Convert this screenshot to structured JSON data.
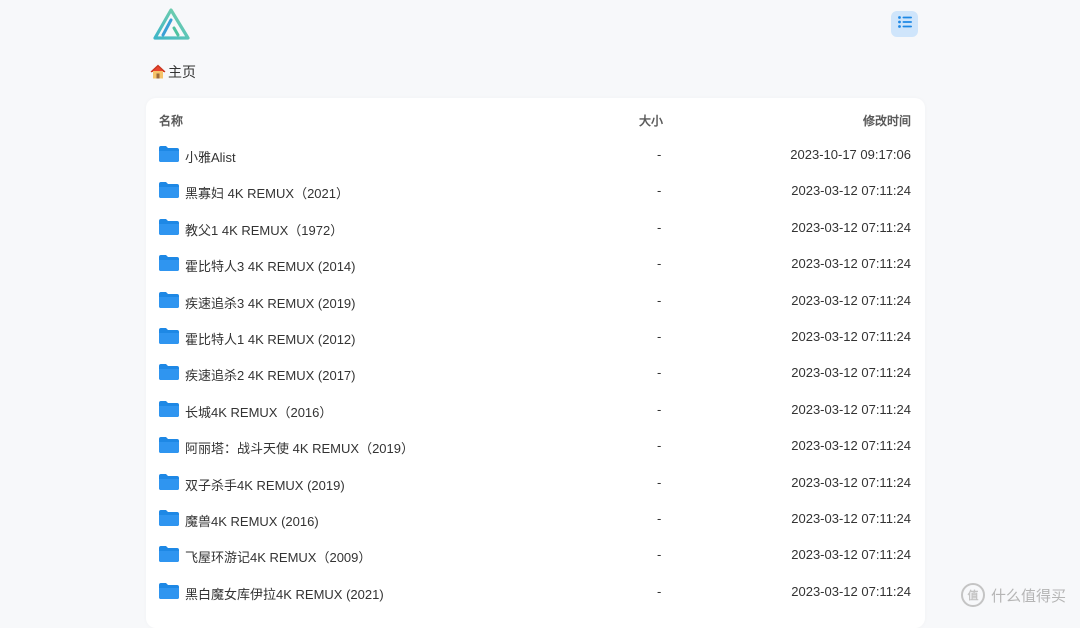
{
  "header": {
    "logo_icon": "alist-logo-icon",
    "menu_icon": "list-icon",
    "accent": "#1e88e5"
  },
  "breadcrumb": {
    "home_icon": "house-icon",
    "label": "主页"
  },
  "table": {
    "columns": [
      "名称",
      "大小",
      "修改时间"
    ],
    "rows": [
      {
        "name": "小雅Alist",
        "size": "-",
        "modified": "2023-10-17 09:17:06"
      },
      {
        "name": "黑寡妇 4K REMUX（2021）",
        "size": "-",
        "modified": "2023-03-12 07:11:24"
      },
      {
        "name": "教父1 4K REMUX（1972）",
        "size": "-",
        "modified": "2023-03-12 07:11:24"
      },
      {
        "name": "霍比特人3 4K REMUX (2014)",
        "size": "-",
        "modified": "2023-03-12 07:11:24"
      },
      {
        "name": "疾速追杀3 4K REMUX (2019)",
        "size": "-",
        "modified": "2023-03-12 07:11:24"
      },
      {
        "name": "霍比特人1 4K REMUX (2012)",
        "size": "-",
        "modified": "2023-03-12 07:11:24"
      },
      {
        "name": "疾速追杀2 4K REMUX (2017)",
        "size": "-",
        "modified": "2023-03-12 07:11:24"
      },
      {
        "name": "长城4K REMUX（2016）",
        "size": "-",
        "modified": "2023-03-12 07:11:24"
      },
      {
        "name": "阿丽塔：战斗天使 4K REMUX（2019）",
        "size": "-",
        "modified": "2023-03-12 07:11:24"
      },
      {
        "name": "双子杀手4K REMUX (2019)",
        "size": "-",
        "modified": "2023-03-12 07:11:24"
      },
      {
        "name": "魔兽4K REMUX (2016)",
        "size": "-",
        "modified": "2023-03-12 07:11:24"
      },
      {
        "name": "飞屋环游记4K REMUX（2009）",
        "size": "-",
        "modified": "2023-03-12 07:11:24"
      },
      {
        "name": "黑白魔女库伊拉4K REMUX (2021)",
        "size": "-",
        "modified": "2023-03-12 07:11:24"
      }
    ]
  },
  "watermark": {
    "badge": "值",
    "text": "什么值得买"
  }
}
